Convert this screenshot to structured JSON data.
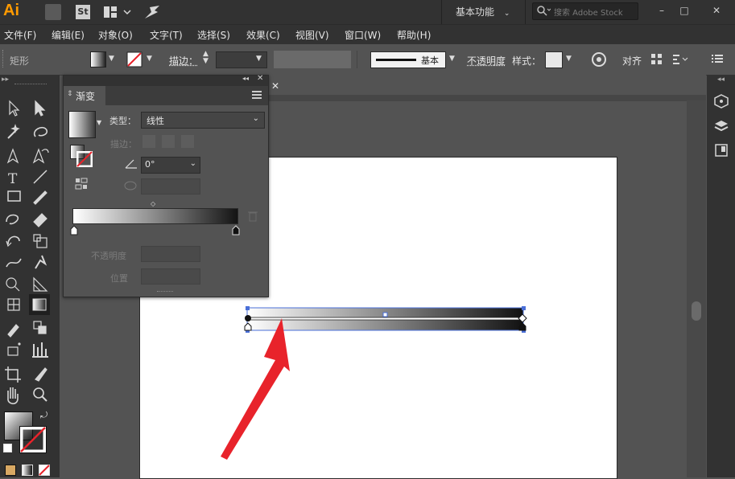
{
  "app": {
    "logo": "Ai",
    "st_label": "St",
    "workspace": "基本功能",
    "search_placeholder": "搜索 Adobe Stock",
    "win_min": "–",
    "win_max": "□",
    "win_close": "✕"
  },
  "menu": [
    "文件(F)",
    "编辑(E)",
    "对象(O)",
    "文字(T)",
    "选择(S)",
    "效果(C)",
    "视图(V)",
    "窗口(W)",
    "帮助(H)"
  ],
  "control": {
    "object_type": "矩形",
    "stroke_label": "描边：",
    "stroke_profile": "基本",
    "opacity_label": "不透明度",
    "style_label": "样式：",
    "align_label": "对齐"
  },
  "gradient_panel": {
    "title": "渐变",
    "type_label": "类型：",
    "type_value": "线性",
    "stroke_label": "描边：",
    "angle_value": "0°",
    "opacity_label": "不透明度",
    "position_label": "位置",
    "gradient_start": "#ffffff",
    "gradient_end": "#141414"
  },
  "colors": {
    "ui_dark": "#323232",
    "ui_mid": "#535353",
    "logo": "#ff9a00",
    "arrow_red": "#e8232b",
    "selection_blue": "#4a6fd8"
  },
  "icons": {
    "tool_list": [
      "selection-icon",
      "direct-selection-icon",
      "magic-wand-icon",
      "lasso-icon",
      "pen-icon",
      "curvature-icon",
      "type-icon",
      "line-icon",
      "rectangle-icon",
      "paintbrush-icon",
      "shaper-icon",
      "eraser-icon",
      "rotate-icon",
      "scale-icon",
      "width-icon",
      "puppet-warp-icon",
      "shape-builder-icon",
      "perspective-grid-icon",
      "mesh-icon",
      "gradient-icon",
      "eyedropper-icon",
      "blend-icon",
      "symbol-sprayer-icon",
      "column-graph-icon",
      "artboard-icon",
      "slice-icon",
      "hand-icon",
      "zoom-icon"
    ]
  },
  "doc": {
    "tab_close": "✕"
  }
}
